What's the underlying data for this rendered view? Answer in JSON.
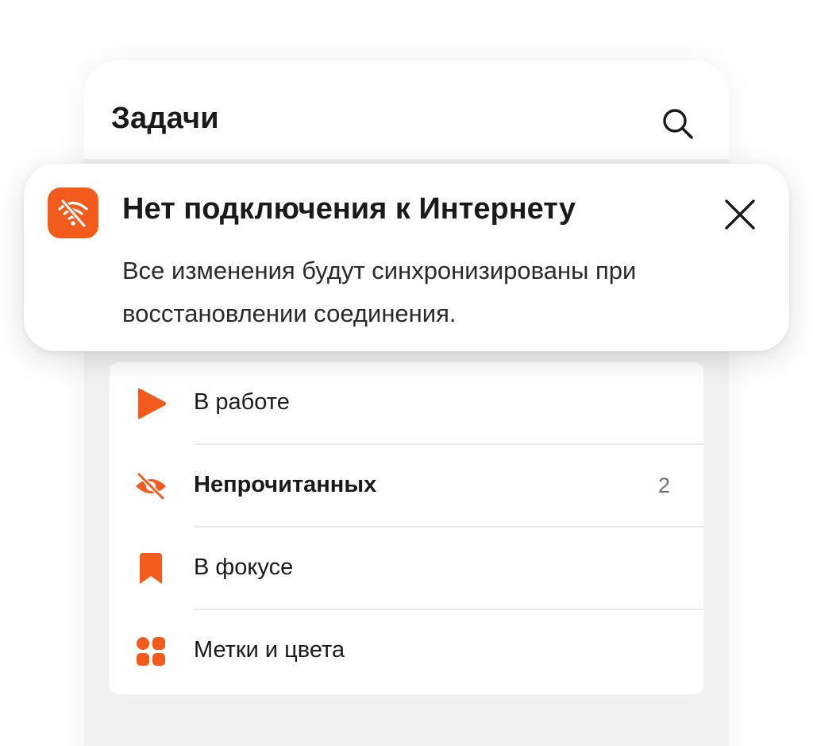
{
  "header": {
    "title": "Задачи",
    "search_icon": "search-icon"
  },
  "toast": {
    "icon": "wifi-off-icon",
    "title": "Нет подключения к Интернету",
    "message": "Все изменения будут синхронизированы при восстановлении соединения.",
    "close_icon": "close-icon"
  },
  "lists": {
    "items": [
      {
        "label": "В работе",
        "icon": "play-icon",
        "count": ""
      },
      {
        "label": "Непрочитанных",
        "icon": "eye-off-icon",
        "count": "2",
        "bold": true
      },
      {
        "label": "В фокусе",
        "icon": "bookmark-icon",
        "count": ""
      },
      {
        "label": "Метки и цвета",
        "icon": "tags-grid-icon",
        "count": ""
      }
    ]
  },
  "colors": {
    "accent": "#f35b1c",
    "panel_bg": "#f1f1f3",
    "card_bg": "#ffffff",
    "text": "#1a1a1a",
    "muted": "#6e6e73"
  }
}
